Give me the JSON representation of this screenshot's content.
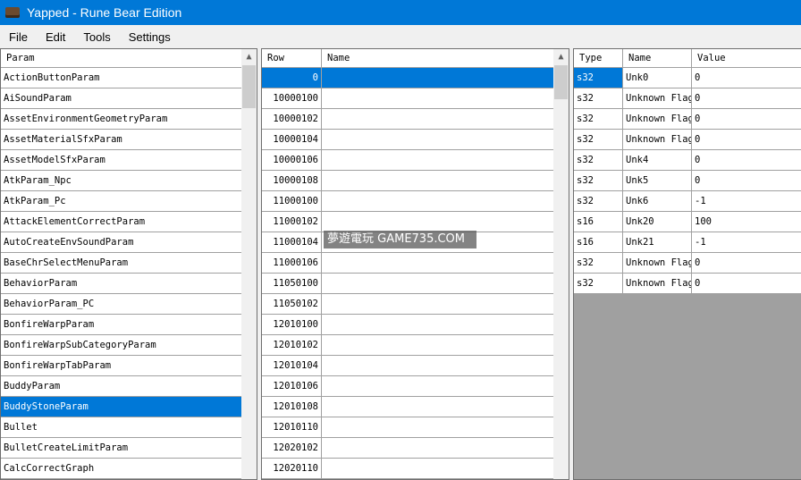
{
  "window": {
    "title": "Yapped - Rune Bear Edition"
  },
  "menu": [
    "File",
    "Edit",
    "Tools",
    "Settings"
  ],
  "params": {
    "header": "Param",
    "items": [
      "ActionButtonParam",
      "AiSoundParam",
      "AssetEnvironmentGeometryParam",
      "AssetMaterialSfxParam",
      "AssetModelSfxParam",
      "AtkParam_Npc",
      "AtkParam_Pc",
      "AttackElementCorrectParam",
      "AutoCreateEnvSoundParam",
      "BaseChrSelectMenuParam",
      "BehaviorParam",
      "BehaviorParam_PC",
      "BonfireWarpParam",
      "BonfireWarpSubCategoryParam",
      "BonfireWarpTabParam",
      "BuddyParam",
      "BuddyStoneParam",
      "Bullet",
      "BulletCreateLimitParam",
      "CalcCorrectGraph"
    ],
    "selected": 16
  },
  "rows": {
    "headers": [
      "Row",
      "Name"
    ],
    "items": [
      "0",
      "10000100",
      "10000102",
      "10000104",
      "10000106",
      "10000108",
      "11000100",
      "11000102",
      "11000104",
      "11000106",
      "11050100",
      "11050102",
      "12010100",
      "12010102",
      "12010104",
      "12010106",
      "12010108",
      "12010110",
      "12020102",
      "12020110"
    ],
    "selected": 0
  },
  "fields": {
    "headers": [
      "Type",
      "Name",
      "Value"
    ],
    "items": [
      [
        "s32",
        "Unk0",
        "0"
      ],
      [
        "s32",
        "Unknown Flag",
        "0"
      ],
      [
        "s32",
        "Unknown Flag",
        "0"
      ],
      [
        "s32",
        "Unknown Flag",
        "0"
      ],
      [
        "s32",
        "Unk4",
        "0"
      ],
      [
        "s32",
        "Unk5",
        "0"
      ],
      [
        "s32",
        "Unk6",
        "-1"
      ],
      [
        "s16",
        "Unk20",
        "100"
      ],
      [
        "s16",
        "Unk21",
        "-1"
      ],
      [
        "s32",
        "Unknown Flag",
        "0"
      ],
      [
        "s32",
        "Unknown Flag",
        "0"
      ]
    ]
  },
  "watermark": "夢遊電玩 GAME735.COM"
}
